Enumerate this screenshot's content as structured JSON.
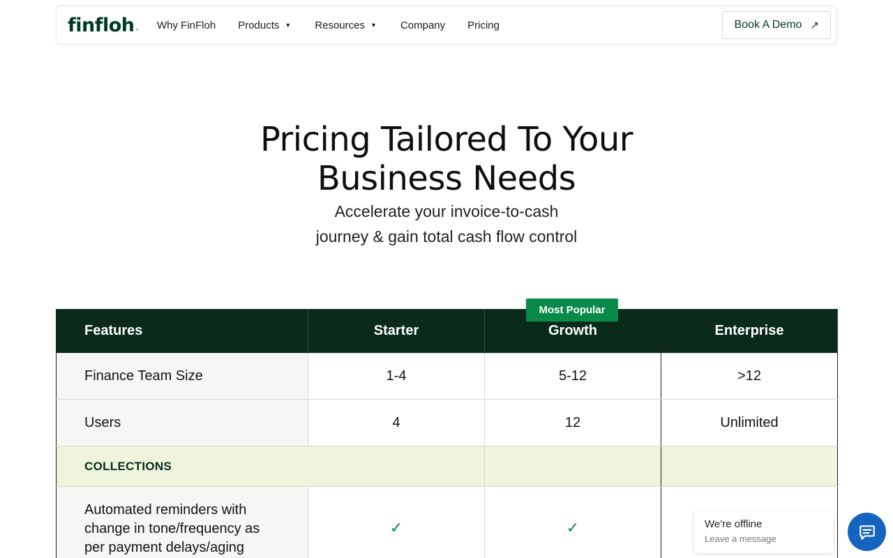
{
  "nav": {
    "logo": "finfloh",
    "logo_tm": "™",
    "links": [
      "Why FinFloh",
      "Products",
      "Resources",
      "Company",
      "Pricing"
    ],
    "demo_label": "Book A Demo"
  },
  "hero": {
    "title_line1": "Pricing Tailored To Your",
    "title_line2": "Business Needs",
    "sub_line1": "Accelerate your invoice-to-cash",
    "sub_line2": "journey & gain total cash flow control"
  },
  "table": {
    "badge": "Most Popular",
    "headers": [
      "Features",
      "Starter",
      "Growth",
      "Enterprise"
    ],
    "rows": [
      {
        "feature": "Finance Team Size",
        "starter": "1-4",
        "growth": "5-12",
        "enterprise": ">12"
      },
      {
        "feature": "Users",
        "starter": "4",
        "growth": "12",
        "enterprise": "Unlimited"
      }
    ],
    "section": "COLLECTIONS",
    "feature_row": {
      "line1": "Automated reminders with",
      "line2": "change in tone/frequency as",
      "line3": "per payment delays/aging"
    },
    "check": "✓"
  },
  "chat": {
    "status": "We're offline",
    "message": "Leave a message"
  },
  "colors": {
    "brand_dark": "#0a2a1a",
    "brand_green": "#0a8a4a",
    "section_bg": "#eef5dc",
    "chat_blue": "#1565c0"
  }
}
